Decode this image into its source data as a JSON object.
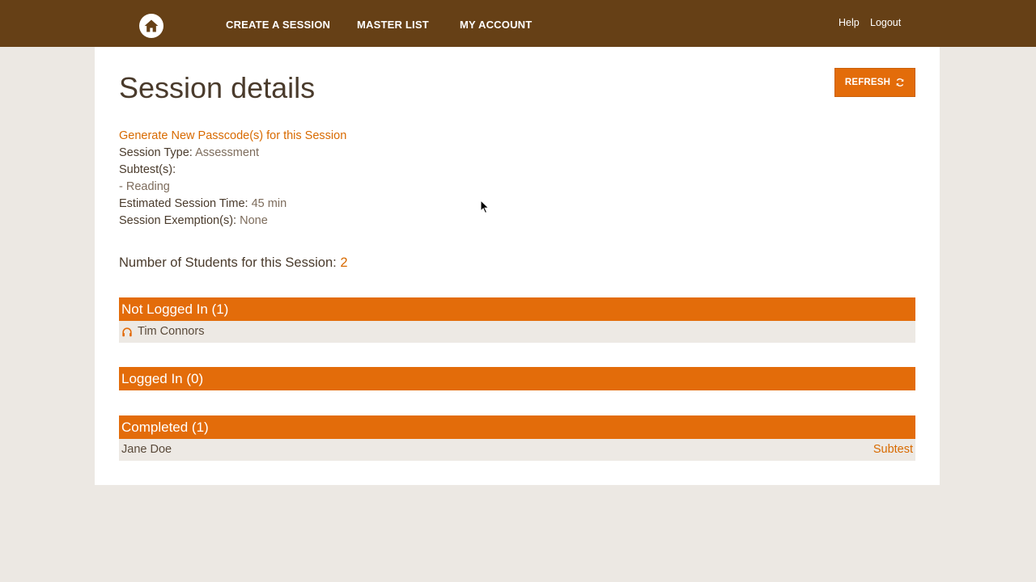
{
  "nav": {
    "items": [
      {
        "label": "CREATE A SESSION"
      },
      {
        "label": "MASTER LIST"
      },
      {
        "label": "MY ACCOUNT"
      }
    ],
    "help_label": "Help",
    "logout_label": "Logout"
  },
  "page": {
    "title": "Session details",
    "refresh_label": "REFRESH"
  },
  "details": {
    "generate_link": "Generate New Passcode(s) for this Session",
    "session_type_label": "Session Type:",
    "session_type_value": "Assessment",
    "subtests_label": "Subtest(s):",
    "subtest_item": " - Reading",
    "est_time_label": "Estimated Session Time:",
    "est_time_value": "45 min",
    "exemptions_label": "Session Exemption(s):",
    "exemptions_value": "None"
  },
  "students": {
    "count_label": "Number of Students for this Session:",
    "count_value": "2"
  },
  "groups": {
    "not_logged_in": {
      "title": "Not Logged In (1)",
      "students": [
        {
          "name": "Tim Connors",
          "icon": "headphones-icon"
        }
      ]
    },
    "logged_in": {
      "title": "Logged In (0)"
    },
    "completed": {
      "title": "Completed (1)",
      "students": [
        {
          "name": "Jane Doe",
          "action": "Subtest"
        }
      ]
    }
  },
  "colors": {
    "topbar": "#664016",
    "accent": "#e36c0a",
    "background": "#ece8e3"
  }
}
